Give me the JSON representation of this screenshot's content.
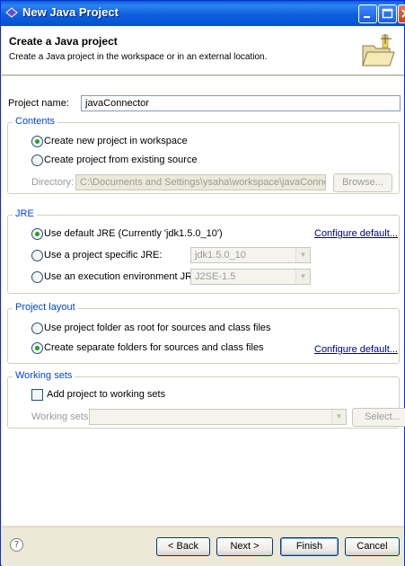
{
  "window": {
    "title": "New Java Project"
  },
  "banner": {
    "title": "Create a Java project",
    "subtitle": "Create a Java project in the workspace or in an external location."
  },
  "project_name": {
    "label": "Project name:",
    "value": "javaConnector"
  },
  "contents": {
    "title": "Contents",
    "opt_new": "Create new project in workspace",
    "opt_existing": "Create project from existing source",
    "directory_label": "Directory:",
    "directory_value": "C:\\Documents and Settings\\ysaha\\workspace\\javaConnector",
    "browse": "Browse..."
  },
  "jre": {
    "title": "JRE",
    "opt_default": "Use default JRE (Currently 'jdk1.5.0_10')",
    "configure": "Configure default...",
    "opt_specific": "Use a project specific JRE:",
    "specific_value": "jdk1.5.0_10",
    "opt_env": "Use an execution environment JRE:",
    "env_value": "J2SE-1.5"
  },
  "layout": {
    "title": "Project layout",
    "opt_root": "Use project folder as root for sources and class files",
    "opt_separate": "Create separate folders for sources and class files",
    "configure": "Configure default..."
  },
  "working_sets": {
    "title": "Working sets",
    "add_label": "Add project to working sets",
    "sets_label": "Working sets:",
    "sets_value": "",
    "select": "Select..."
  },
  "footer": {
    "help": "?",
    "back": "< Back",
    "next": "Next >",
    "finish": "Finish",
    "cancel": "Cancel"
  },
  "colors": {
    "titlebar": "#0a5fd8",
    "group_title": "#0046d5",
    "link": "#00008b"
  },
  "icons": [
    "java-app-icon",
    "minimize-icon",
    "maximize-icon",
    "close-icon",
    "new-folder-icon",
    "help-icon",
    "dropdown-arrow-icon"
  ]
}
